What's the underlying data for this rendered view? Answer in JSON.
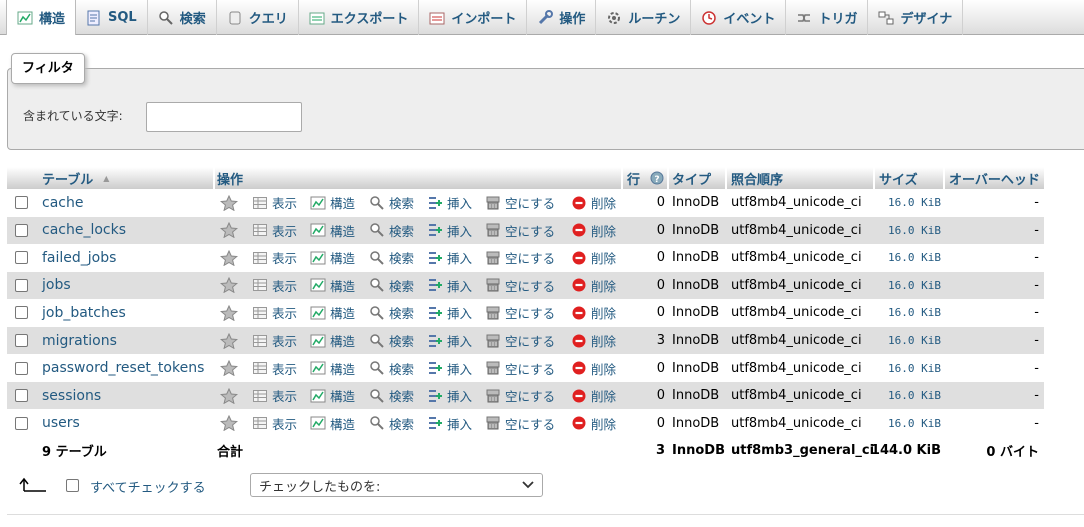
{
  "tabs": [
    {
      "label": "構造",
      "icon": "structure-icon",
      "active": true
    },
    {
      "label": "SQL",
      "icon": "sql-icon"
    },
    {
      "label": "検索",
      "icon": "search-icon"
    },
    {
      "label": "クエリ",
      "icon": "query-icon"
    },
    {
      "label": "エクスポート",
      "icon": "export-icon"
    },
    {
      "label": "インポート",
      "icon": "import-icon"
    },
    {
      "label": "操作",
      "icon": "wrench-icon"
    },
    {
      "label": "ルーチン",
      "icon": "routines-icon"
    },
    {
      "label": "イベント",
      "icon": "clock-icon"
    },
    {
      "label": "トリガ",
      "icon": "triggers-icon"
    },
    {
      "label": "デザイナ",
      "icon": "designer-icon"
    }
  ],
  "filter": {
    "legend": "フィルタ",
    "label": "含まれている文字:",
    "value": ""
  },
  "table_header": {
    "table": "テーブル",
    "sort_indicator": "▲",
    "action": "操作",
    "rows": "行",
    "type": "タイプ",
    "collation": "照合順序",
    "size": "サイズ",
    "overhead": "オーバーヘッド"
  },
  "actions": {
    "browse": "表示",
    "structure": "構造",
    "search": "検索",
    "insert": "挿入",
    "empty": "空にする",
    "drop": "削除"
  },
  "tables": [
    {
      "name": "cache",
      "rows": "0",
      "type": "InnoDB",
      "collation": "utf8mb4_unicode_ci",
      "size": "16.0 KiB",
      "overhead": "-"
    },
    {
      "name": "cache_locks",
      "rows": "0",
      "type": "InnoDB",
      "collation": "utf8mb4_unicode_ci",
      "size": "16.0 KiB",
      "overhead": "-"
    },
    {
      "name": "failed_jobs",
      "rows": "0",
      "type": "InnoDB",
      "collation": "utf8mb4_unicode_ci",
      "size": "16.0 KiB",
      "overhead": "-"
    },
    {
      "name": "jobs",
      "rows": "0",
      "type": "InnoDB",
      "collation": "utf8mb4_unicode_ci",
      "size": "16.0 KiB",
      "overhead": "-"
    },
    {
      "name": "job_batches",
      "rows": "0",
      "type": "InnoDB",
      "collation": "utf8mb4_unicode_ci",
      "size": "16.0 KiB",
      "overhead": "-"
    },
    {
      "name": "migrations",
      "rows": "3",
      "type": "InnoDB",
      "collation": "utf8mb4_unicode_ci",
      "size": "16.0 KiB",
      "overhead": "-"
    },
    {
      "name": "password_reset_tokens",
      "rows": "0",
      "type": "InnoDB",
      "collation": "utf8mb4_unicode_ci",
      "size": "16.0 KiB",
      "overhead": "-"
    },
    {
      "name": "sessions",
      "rows": "0",
      "type": "InnoDB",
      "collation": "utf8mb4_unicode_ci",
      "size": "16.0 KiB",
      "overhead": "-"
    },
    {
      "name": "users",
      "rows": "0",
      "type": "InnoDB",
      "collation": "utf8mb4_unicode_ci",
      "size": "16.0 KiB",
      "overhead": "-"
    }
  ],
  "footer": {
    "count": "9 テーブル",
    "total_label": "合計",
    "rows": "3",
    "type": "InnoDB",
    "collation": "utf8mb3_general_ci",
    "size": "144.0 KiB",
    "overhead": "0 バイト"
  },
  "bottom": {
    "check_all": "すべてチェックする",
    "with_selected": "チェックしたものを:"
  },
  "colors": {
    "link": "#235a81",
    "row_alt": "#dfdfdf",
    "drop_red": "#e02020"
  }
}
